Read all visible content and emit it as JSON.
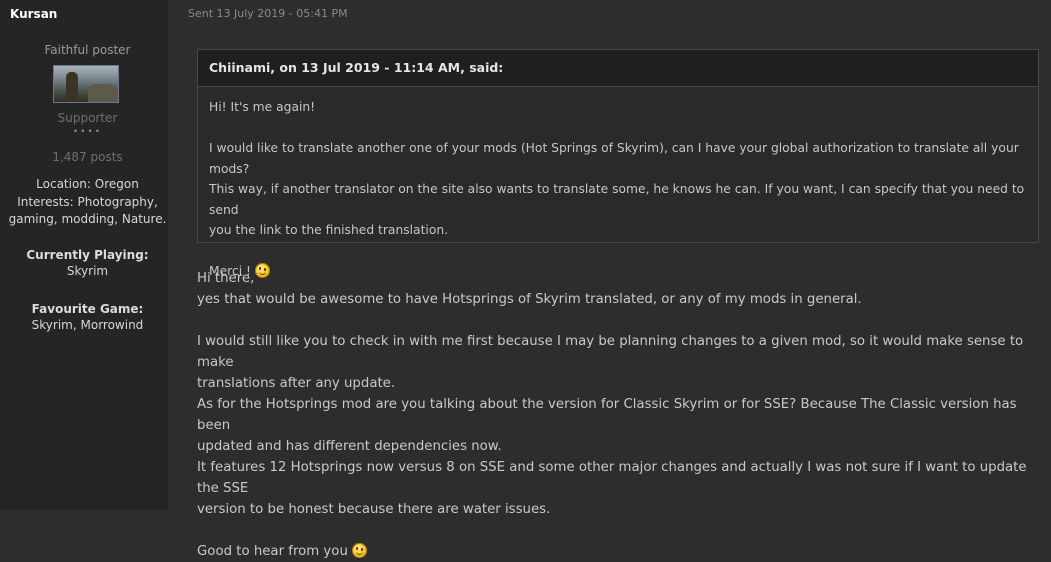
{
  "author": {
    "name": "Kursan",
    "rank": "Faithful poster",
    "group": "Supporter",
    "pips": "••••",
    "posts": "1,487 posts",
    "location": "Location: Oregon",
    "interests_1": "Interests: Photography,",
    "interests_2": "gaming, modding, Nature.",
    "field1_title": "Currently Playing:",
    "field1_value": "Skyrim",
    "field2_title": "Favourite Game:",
    "field2_value": "Skyrim, Morrowind"
  },
  "post": {
    "sent": "Sent 13 July 2019 - 05:41 PM",
    "quote": {
      "header": "Chiinami, on 13 Jul 2019 - 11:14 AM, said:",
      "line1": "Hi! It's me again!",
      "line2": "I would like to translate another one of your mods (Hot Springs of Skyrim), can I have your global authorization to translate all your mods?",
      "line3": "This way, if another translator on the site also wants to translate some, he knows he can. If you want, I can specify that you need to send",
      "line4": "you the link to the finished translation.",
      "line5": "Merci !"
    },
    "reply": {
      "l1": "Hi there,",
      "l2": "yes that would be awesome to have Hotsprings of Skyrim translated, or any of my mods in general.",
      "l3": "I would still like you to check in with me first because I may be planning changes to a given mod, so it would make sense to make",
      "l4": "translations after any update.",
      "l5": "As for the Hotsprings mod are you talking about the version for Classic Skyrim or for SSE? Because The Classic version has been",
      "l6": "updated and has different dependencies now.",
      "l7": "It features 12 Hotsprings now versus 8 on SSE and some other major changes and actually I was not sure if I want to update the SSE",
      "l8": "version to be honest because there are water issues.",
      "l9": "Good to hear from you"
    }
  }
}
